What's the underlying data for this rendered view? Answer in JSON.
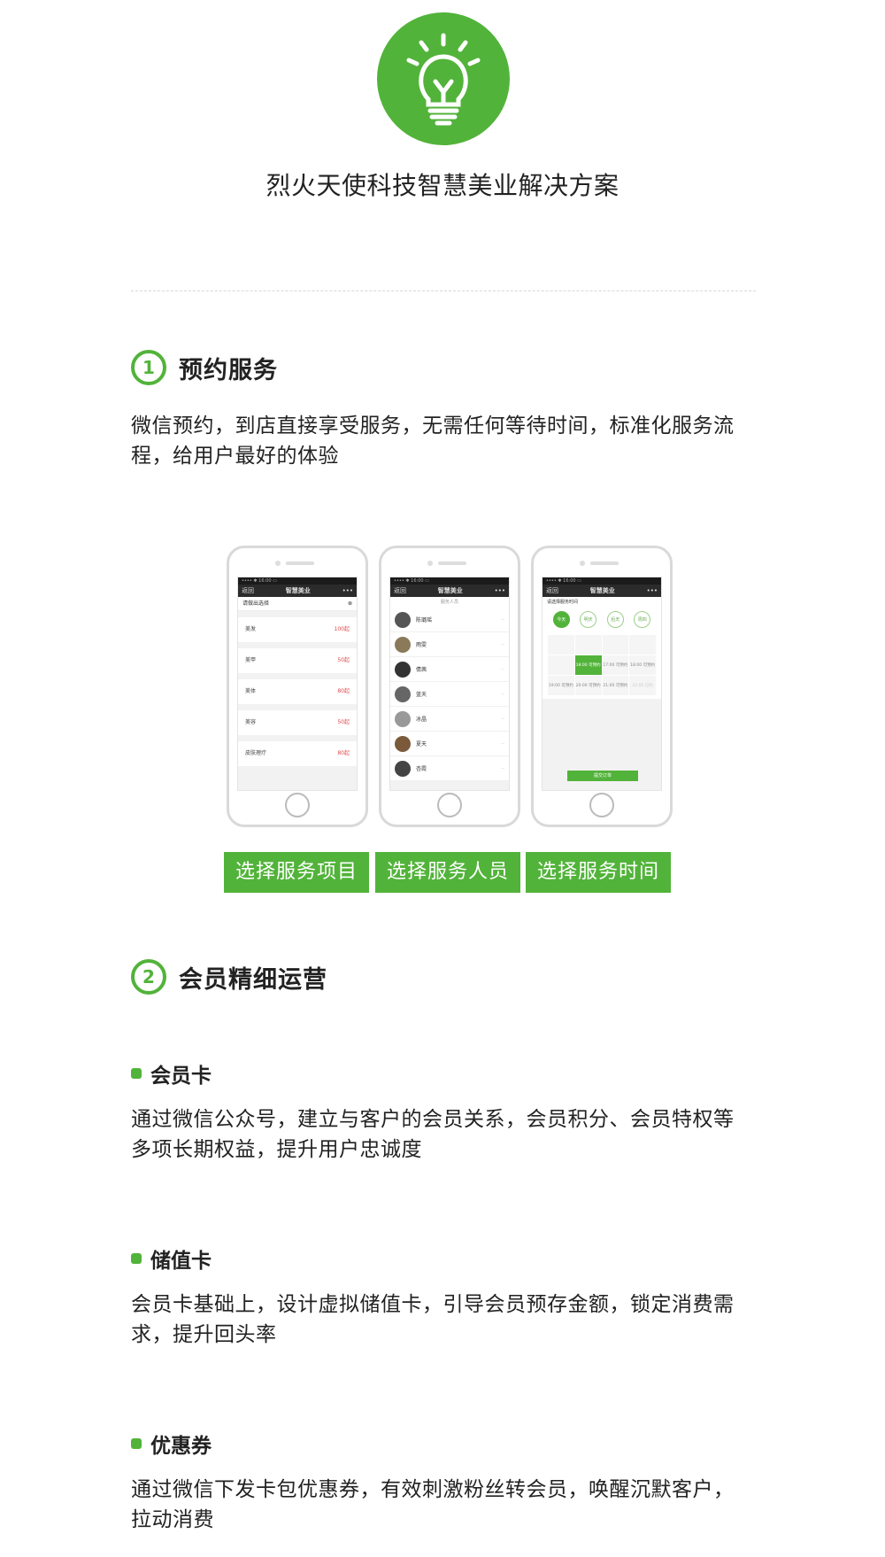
{
  "brand_color": "#52b33a",
  "page_title": "烈火天使科技智慧美业解决方案",
  "logo_icon": "lightbulb-icon",
  "section1": {
    "number": "1",
    "title": "预约服务",
    "description": "微信预约，到店直接享受服务，无需任何等待时间，标准化服务流程，给用户最好的体验",
    "phones": [
      {
        "nav_back": "返回",
        "nav_title": "智慧美业",
        "nav_more": "•••",
        "top_label": "请做出选择",
        "items": [
          {
            "name": "美发",
            "price": "100起"
          },
          {
            "name": "美甲",
            "price": "50起"
          },
          {
            "name": "美体",
            "price": "80起"
          },
          {
            "name": "美容",
            "price": "50起"
          },
          {
            "name": "皮肤理疗",
            "price": "80起"
          }
        ]
      },
      {
        "nav_back": "返回",
        "nav_title": "智慧美业",
        "nav_more": "•••",
        "top_label": "服务人员",
        "staff": [
          "陈璐瑶",
          "雨雯",
          "倩茜",
          "蓝天",
          "冰晶",
          "夏天",
          "杏霞"
        ]
      },
      {
        "nav_back": "返回",
        "nav_title": "智慧美业",
        "nav_more": "•••",
        "top_label": "请选择服务时间",
        "days": [
          "今天",
          "明天",
          "后天",
          "周四"
        ],
        "slots": [
          "",
          "",
          "",
          "",
          "",
          "18:00 可预约",
          "17:00 可预约",
          "18:00 可预约",
          "19:00 可预约",
          "20:00 可预约",
          "21:00 可预约",
          "22:00 已约"
        ],
        "submit": "提交订单"
      }
    ],
    "buttons": [
      "选择服务项目",
      "选择服务人员",
      "选择服务时间"
    ]
  },
  "section2": {
    "number": "2",
    "title": "会员精细运营",
    "items": [
      {
        "title": "会员卡",
        "description": "通过微信公众号，建立与客户的会员关系，会员积分、会员特权等多项长期权益，提升用户忠诚度"
      },
      {
        "title": "储值卡",
        "description": "会员卡基础上，设计虚拟储值卡，引导会员预存金额，锁定消费需求，提升回头率"
      },
      {
        "title": "优惠券",
        "description": "通过微信下发卡包优惠券，有效刺激粉丝转会员，唤醒沉默客户，拉动消费"
      }
    ]
  }
}
